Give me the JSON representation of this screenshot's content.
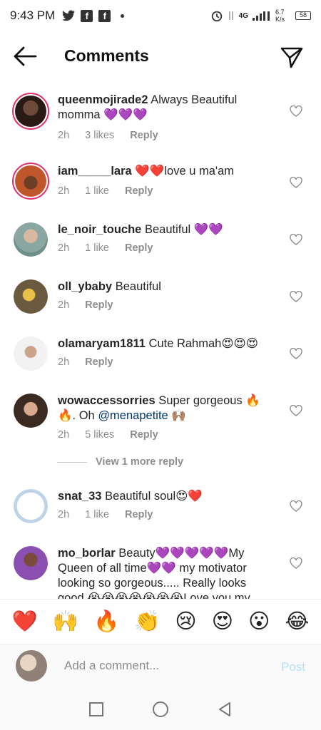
{
  "status_bar": {
    "time": "9:43 PM",
    "network": "4G",
    "speed": "6.7 K/s",
    "battery": "58"
  },
  "header": {
    "title": "Comments"
  },
  "comments": [
    {
      "username": "queenmojirade2",
      "text": "Always Beautiful momma 💜💜💜",
      "time": "2h",
      "likes": "3 likes",
      "reply": "Reply"
    },
    {
      "username": "iam_____lara",
      "text": "❤️❤️love u ma'am",
      "time": "2h",
      "likes": "1 like",
      "reply": "Reply"
    },
    {
      "username": "le_noir_touche",
      "text": "Beautiful 💜💜",
      "time": "2h",
      "likes": "1 like",
      "reply": "Reply"
    },
    {
      "username": "oll_ybaby",
      "text": "Beautiful",
      "time": "2h",
      "likes": "",
      "reply": "Reply"
    },
    {
      "username": "olamaryam1811",
      "text": "Cute Rahmah😍😍😍",
      "time": "2h",
      "likes": "",
      "reply": "Reply"
    },
    {
      "username": "wowaccessorries",
      "text": "Super gorgeous 🔥🔥. Oh ",
      "mention": "@menapetite",
      "after_mention": " 🙌🏽",
      "time": "2h",
      "likes": "5 likes",
      "reply": "Reply"
    },
    {
      "username": "snat_33",
      "text": "Beautiful soul😍❤️",
      "time": "2h",
      "likes": "1 like",
      "reply": "Reply"
    },
    {
      "username": "mo_borlar",
      "text": "Beauty💜💜💜💜💜My Queen of all time💜💜 my motivator looking so gorgeous..... Really looks good 😭😭😭😭😭😭😭Love you my",
      "time": "",
      "likes": "",
      "reply": ""
    }
  ],
  "view_more": "View 1 more reply",
  "quick_emojis": [
    "❤️",
    "🙌",
    "🔥",
    "👏",
    "😢",
    "😍",
    "😮",
    "😂"
  ],
  "composer": {
    "placeholder": "Add a comment...",
    "post_label": "Post"
  },
  "colors": {
    "story_ring": "#e1306c",
    "post_disabled": "#b2dffc",
    "meta_gray": "#8e8e8e",
    "mention": "#00376b"
  }
}
